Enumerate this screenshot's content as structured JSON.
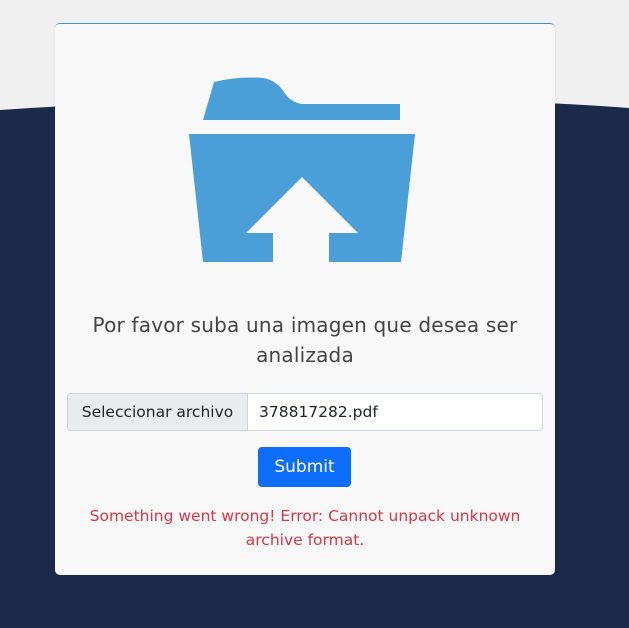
{
  "upload": {
    "icon": "folder-upload-icon",
    "prompt": "Por favor suba una imagen que desea ser analizada",
    "file_button_label": "Seleccionar archivo",
    "selected_file": "378817282.pdf",
    "submit_label": "Submit",
    "error_message": "Something went wrong! Error: Cannot unpack unknown archive format."
  },
  "colors": {
    "background_dark": "#1b2a4a",
    "background_light": "#f0f0f0",
    "card": "#f8f8f8",
    "icon": "#4a9fd8",
    "primary": "#0d6efd",
    "error": "#dc3545"
  }
}
